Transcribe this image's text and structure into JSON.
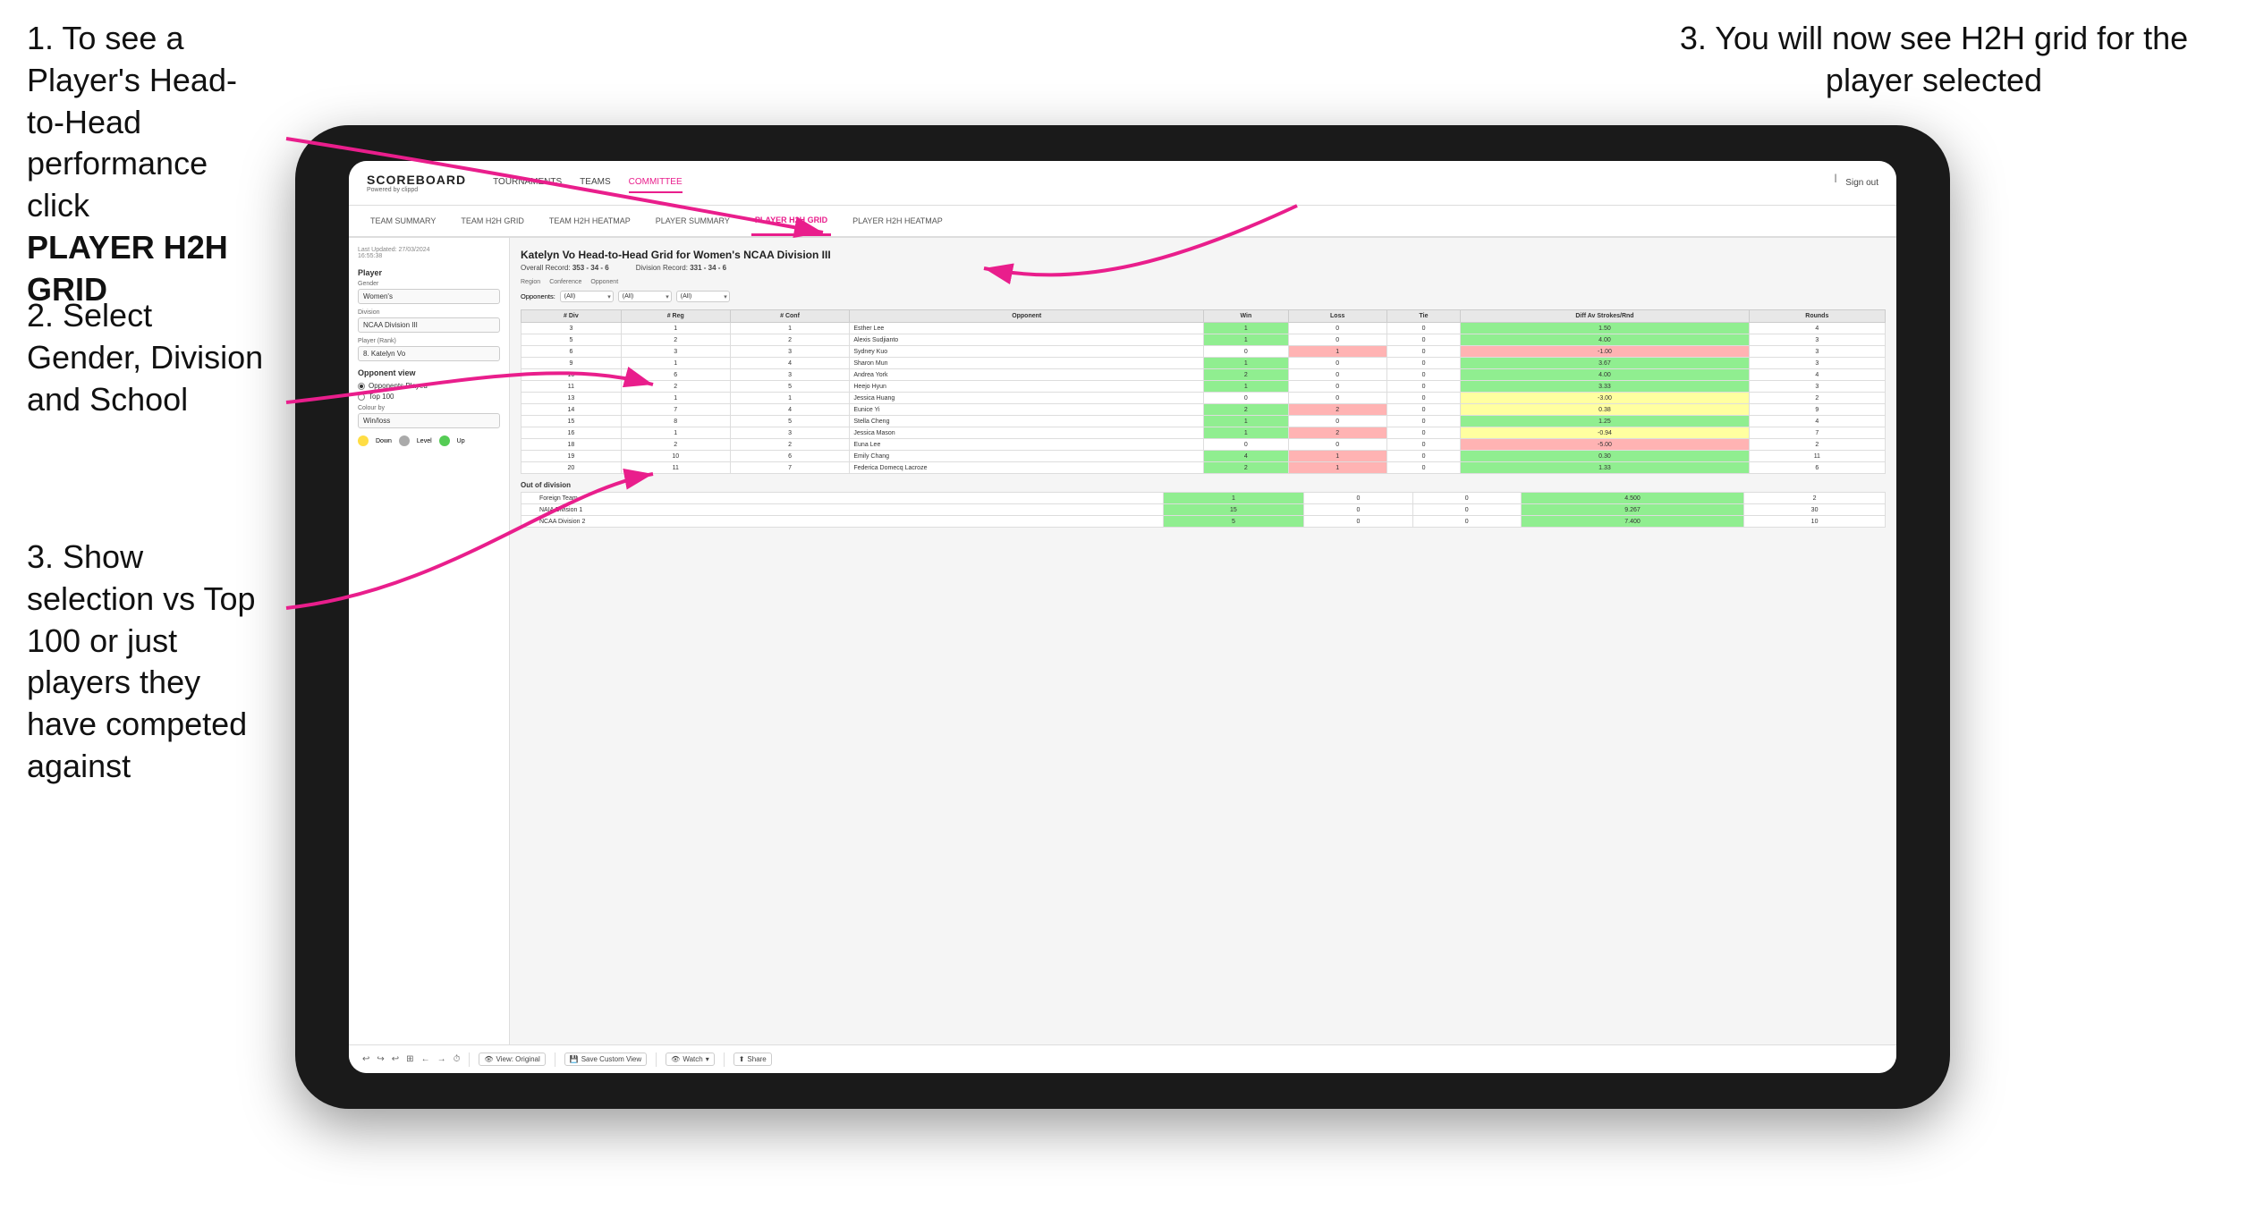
{
  "instructions": {
    "step1": "1. To see a Player's Head-to-Head performance click",
    "step1_bold": "PLAYER H2H GRID",
    "step2": "2. Select Gender, Division and School",
    "step3_left": "3. Show selection vs Top 100 or just players they have competed against",
    "step3_right": "3. You will now see H2H grid for the player selected"
  },
  "nav": {
    "logo": "SCOREBOARD",
    "logo_sub": "Powered by clippd",
    "items": [
      "TOURNAMENTS",
      "TEAMS",
      "COMMITTEE",
      ""
    ],
    "active_item": "COMMITTEE",
    "right": [
      "Sign out"
    ],
    "sub_items": [
      "TEAM SUMMARY",
      "TEAM H2H GRID",
      "TEAM H2H HEATMAP",
      "PLAYER SUMMARY",
      "PLAYER H2H GRID",
      "PLAYER H2H HEATMAP"
    ],
    "active_sub": "PLAYER H2H GRID"
  },
  "sidebar": {
    "timestamp": "Last Updated: 27/03/2024",
    "time": "16:55:38",
    "player_label": "Player",
    "gender_label": "Gender",
    "gender_value": "Women's",
    "division_label": "Division",
    "division_value": "NCAA Division III",
    "player_rank_label": "Player (Rank)",
    "player_rank_value": "8. Katelyn Vo",
    "opponent_view_label": "Opponent view",
    "radio_opponents": "Opponents Played",
    "radio_top100": "Top 100",
    "colour_label": "Colour by",
    "colour_value": "Win/loss",
    "legend_down": "Down",
    "legend_level": "Level",
    "legend_up": "Up"
  },
  "grid": {
    "title": "Katelyn Vo Head-to-Head Grid for Women's NCAA Division III",
    "overall_record_label": "Overall Record:",
    "overall_record": "353 - 34 - 6",
    "division_record_label": "Division Record:",
    "division_record": "331 - 34 - 6",
    "region_label": "Region",
    "conference_label": "Conference",
    "opponent_label": "Opponent",
    "opponents_label": "Opponents:",
    "opponents_value": "(All)",
    "conference_value": "(All)",
    "opponent_filter_value": "(All)",
    "columns": [
      "# Div",
      "# Reg",
      "# Conf",
      "Opponent",
      "Win",
      "Loss",
      "Tie",
      "Diff Av Strokes/Rnd",
      "Rounds"
    ],
    "rows": [
      {
        "div": 3,
        "reg": 1,
        "conf": 1,
        "opponent": "Esther Lee",
        "win": 1,
        "loss": 0,
        "tie": 0,
        "diff": "1.50",
        "rounds": 4,
        "color": "green"
      },
      {
        "div": 5,
        "reg": 2,
        "conf": 2,
        "opponent": "Alexis Sudjianto",
        "win": 1,
        "loss": 0,
        "tie": 0,
        "diff": "4.00",
        "rounds": 3,
        "color": "green"
      },
      {
        "div": 6,
        "reg": 3,
        "conf": 3,
        "opponent": "Sydney Kuo",
        "win": 0,
        "loss": 1,
        "tie": 0,
        "diff": "-1.00",
        "rounds": 3,
        "color": "red"
      },
      {
        "div": 9,
        "reg": 1,
        "conf": 4,
        "opponent": "Sharon Mun",
        "win": 1,
        "loss": 0,
        "tie": 0,
        "diff": "3.67",
        "rounds": 3,
        "color": "green"
      },
      {
        "div": 10,
        "reg": 6,
        "conf": 3,
        "opponent": "Andrea York",
        "win": 2,
        "loss": 0,
        "tie": 0,
        "diff": "4.00",
        "rounds": 4,
        "color": "green"
      },
      {
        "div": 11,
        "reg": 2,
        "conf": 5,
        "opponent": "Heejo Hyun",
        "win": 1,
        "loss": 0,
        "tie": 0,
        "diff": "3.33",
        "rounds": 3,
        "color": "green"
      },
      {
        "div": 13,
        "reg": 1,
        "conf": 1,
        "opponent": "Jessica Huang",
        "win": 0,
        "loss": 0,
        "tie": 0,
        "diff": "-3.00",
        "rounds": 2,
        "color": "yellow"
      },
      {
        "div": 14,
        "reg": 7,
        "conf": 4,
        "opponent": "Eunice Yi",
        "win": 2,
        "loss": 2,
        "tie": 0,
        "diff": "0.38",
        "rounds": 9,
        "color": "yellow"
      },
      {
        "div": 15,
        "reg": 8,
        "conf": 5,
        "opponent": "Stella Cheng",
        "win": 1,
        "loss": 0,
        "tie": 0,
        "diff": "1.25",
        "rounds": 4,
        "color": "green"
      },
      {
        "div": 16,
        "reg": 1,
        "conf": 3,
        "opponent": "Jessica Mason",
        "win": 1,
        "loss": 2,
        "tie": 0,
        "diff": "-0.94",
        "rounds": 7,
        "color": "yellow"
      },
      {
        "div": 18,
        "reg": 2,
        "conf": 2,
        "opponent": "Euna Lee",
        "win": 0,
        "loss": 0,
        "tie": 0,
        "diff": "-5.00",
        "rounds": 2,
        "color": "red"
      },
      {
        "div": 19,
        "reg": 10,
        "conf": 6,
        "opponent": "Emily Chang",
        "win": 4,
        "loss": 1,
        "tie": 0,
        "diff": "0.30",
        "rounds": 11,
        "color": "green"
      },
      {
        "div": 20,
        "reg": 11,
        "conf": 7,
        "opponent": "Federica Domecq Lacroze",
        "win": 2,
        "loss": 1,
        "tie": 0,
        "diff": "1.33",
        "rounds": 6,
        "color": "green"
      }
    ],
    "out_of_division_label": "Out of division",
    "out_of_division_rows": [
      {
        "name": "Foreign Team",
        "win": 1,
        "loss": 0,
        "tie": 0,
        "diff": "4.500",
        "rounds": 2,
        "color": "green"
      },
      {
        "name": "NAIA Division 1",
        "win": 15,
        "loss": 0,
        "tie": 0,
        "diff": "9.267",
        "rounds": 30,
        "color": "green"
      },
      {
        "name": "NCAA Division 2",
        "win": 5,
        "loss": 0,
        "tie": 0,
        "diff": "7.400",
        "rounds": 10,
        "color": "green"
      }
    ]
  },
  "toolbar": {
    "view_original": "View: Original",
    "save_custom": "Save Custom View",
    "watch": "Watch",
    "share": "Share"
  }
}
